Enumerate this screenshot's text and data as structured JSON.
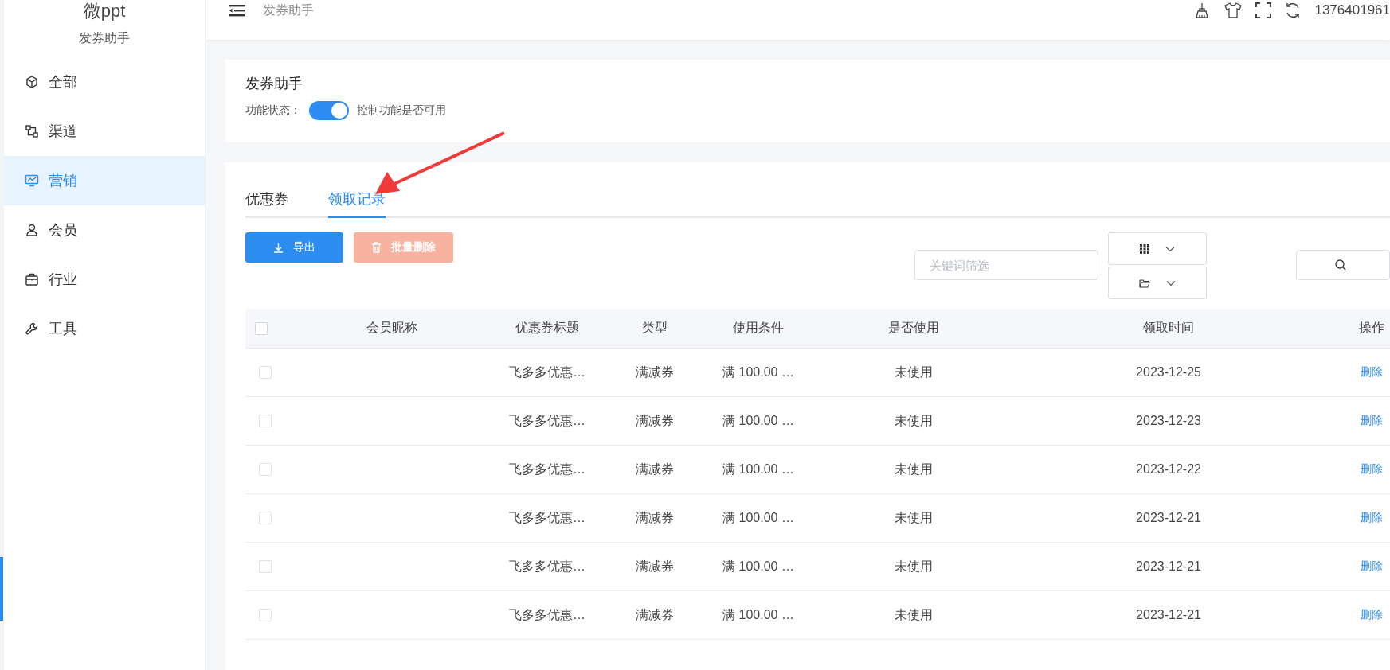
{
  "sidebar": {
    "logo": "微ppt",
    "subtitle": "发券助手",
    "items": [
      {
        "label": "全部",
        "selected": false
      },
      {
        "label": "渠道",
        "selected": false
      },
      {
        "label": "营销",
        "selected": true
      },
      {
        "label": "会员",
        "selected": false
      },
      {
        "label": "行业",
        "selected": false
      },
      {
        "label": "工具",
        "selected": false
      }
    ]
  },
  "header": {
    "breadcrumb": "发券助手",
    "user": "1376401961"
  },
  "feature": {
    "title": "发券助手",
    "status_label": "功能状态：",
    "enabled": true,
    "hint": "控制功能是否可用"
  },
  "tabs": [
    {
      "label": "优惠券",
      "selected": false
    },
    {
      "label": "领取记录",
      "selected": true
    }
  ],
  "toolbar": {
    "buttons": [
      {
        "label": "导出",
        "kind": "primary",
        "disabled": false
      },
      {
        "label": "批量删除",
        "kind": "danger",
        "disabled": true
      }
    ],
    "search": {
      "placeholder": "关键词筛选"
    }
  },
  "table": {
    "all_checked": false,
    "columns": [
      "会员昵称",
      "优惠券标题",
      "类型",
      "使用条件",
      "是否使用",
      "领取时间",
      "操作"
    ],
    "rows": [
      {
        "checked": false,
        "title": "飞多多优惠…",
        "type": "满减券",
        "condition": "满 100.00 …",
        "used": "未使用",
        "time": "2023-12-25",
        "action": "删除"
      },
      {
        "checked": false,
        "title": "飞多多优惠…",
        "type": "满减券",
        "condition": "满 100.00 …",
        "used": "未使用",
        "time": "2023-12-23",
        "action": "删除"
      },
      {
        "checked": false,
        "title": "飞多多优惠…",
        "type": "满减券",
        "condition": "满 100.00 …",
        "used": "未使用",
        "time": "2023-12-22",
        "action": "删除"
      },
      {
        "checked": false,
        "title": "飞多多优惠…",
        "type": "满减券",
        "condition": "满 100.00 …",
        "used": "未使用",
        "time": "2023-12-21",
        "action": "删除"
      },
      {
        "checked": false,
        "title": "飞多多优惠…",
        "type": "满减券",
        "condition": "满 100.00 …",
        "used": "未使用",
        "time": "2023-12-21",
        "action": "删除"
      },
      {
        "checked": false,
        "title": "飞多多优惠…",
        "type": "满减券",
        "condition": "满 100.00 …",
        "used": "未使用",
        "time": "2023-12-21",
        "action": "删除"
      }
    ]
  }
}
